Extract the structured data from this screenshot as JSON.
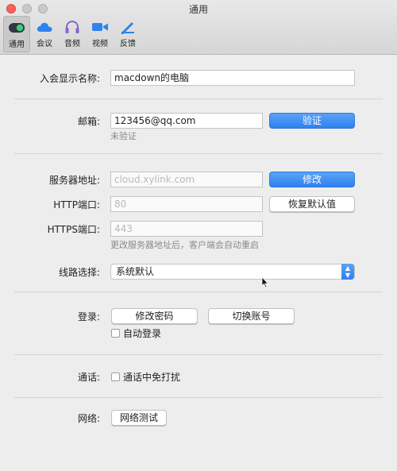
{
  "window": {
    "title": "通用"
  },
  "tabs": [
    {
      "label": "通用",
      "icon": "toggle-switch-icon",
      "active": true
    },
    {
      "label": "会议",
      "icon": "cloud-icon"
    },
    {
      "label": "音频",
      "icon": "headphones-icon"
    },
    {
      "label": "视频",
      "icon": "video-camera-icon"
    },
    {
      "label": "反馈",
      "icon": "pencil-paper-icon"
    }
  ],
  "display_name": {
    "label": "入会显示名称:",
    "value": "macdown的电脑"
  },
  "email": {
    "label": "邮箱:",
    "value": "123456@qq.com",
    "button": "验证",
    "status": "未验证"
  },
  "server": {
    "address_label": "服务器地址:",
    "address_value": "cloud.xylink.com",
    "modify_button": "修改",
    "http_label": "HTTP端口:",
    "http_value": "80",
    "restore_button": "恢复默认值",
    "https_label": "HTTPS端口:",
    "https_value": "443",
    "hint": "更改服务器地址后，客户端会自动重启"
  },
  "route": {
    "label": "线路选择:",
    "value": "系统默认"
  },
  "login": {
    "label": "登录:",
    "change_password": "修改密码",
    "switch_account": "切换账号",
    "auto_login": "自动登录"
  },
  "call": {
    "label": "通话:",
    "dnd": "通话中免打扰"
  },
  "network": {
    "label": "网络:",
    "test_button": "网络测试"
  },
  "colors": {
    "accent": "#3a8cf2",
    "close": "#fc605c"
  }
}
